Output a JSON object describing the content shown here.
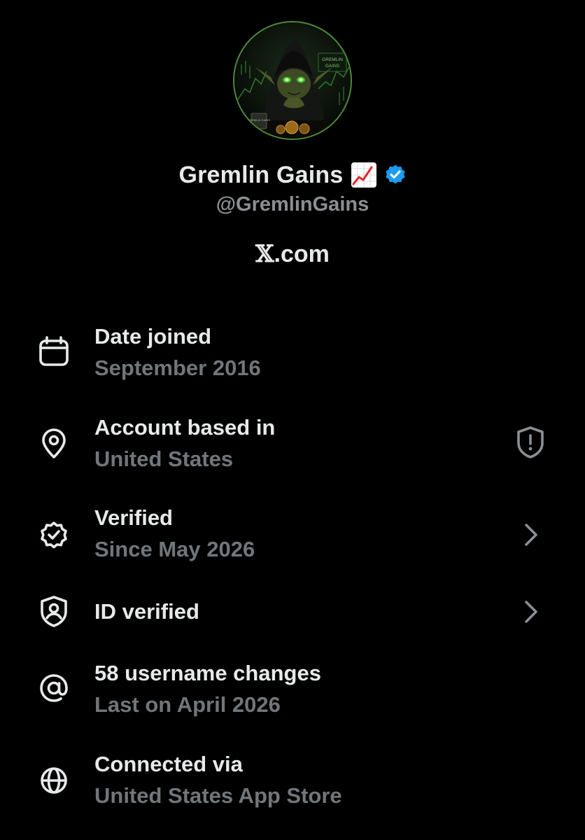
{
  "profile": {
    "display_name": "Gremlin Gains",
    "name_emoji": "chart-increasing-emoji",
    "verified_badge": "blue-checkmark-icon",
    "handle": "@GremlinGains",
    "site": {
      "x_glyph": "𝕏",
      "suffix": ".com"
    },
    "avatar_text": {
      "sign_top": "GREMLIN",
      "sign_bottom": "GAINS",
      "mug": "GREMLIN GAINS"
    }
  },
  "rows": [
    {
      "icon": "calendar-icon",
      "title": "Date joined",
      "subtitle": "September 2016",
      "trailing": null
    },
    {
      "icon": "location-pin-icon",
      "title": "Account based in",
      "subtitle": "United States",
      "trailing": "shield-alert-icon"
    },
    {
      "icon": "verified-seal-icon",
      "title": "Verified",
      "subtitle": "Since May 2026",
      "trailing": "chevron-right-icon"
    },
    {
      "icon": "id-shield-icon",
      "title": "ID verified",
      "subtitle": "",
      "trailing": "chevron-right-icon"
    },
    {
      "icon": "at-sign-icon",
      "title": "58 username changes",
      "subtitle": "Last on April 2026",
      "trailing": null
    },
    {
      "icon": "globe-icon",
      "title": "Connected via",
      "subtitle": "United States App Store",
      "trailing": null
    }
  ],
  "colors": {
    "background": "#000000",
    "primary_text": "#e7e9ea",
    "secondary_text": "#71767b",
    "verified_blue": "#1d9bf0",
    "avatar_glow": "#4cff3a"
  }
}
